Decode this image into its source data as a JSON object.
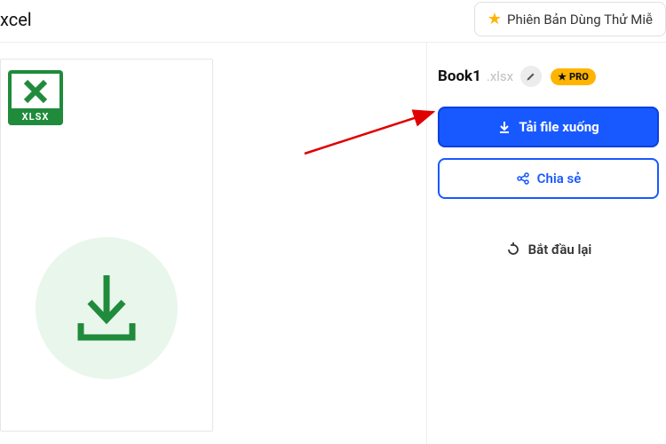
{
  "topbar": {
    "left_text": "xcel",
    "trial_label": "Phiên Bản Dùng Thử Miễ"
  },
  "preview": {
    "badge_label": "XLSX"
  },
  "side": {
    "file_name": "Book1",
    "file_ext": ".xlsx",
    "pro_label": "PRO",
    "download_label": "Tải file xuống",
    "share_label": "Chia sẻ",
    "restart_label": "Bắt đầu lại"
  }
}
